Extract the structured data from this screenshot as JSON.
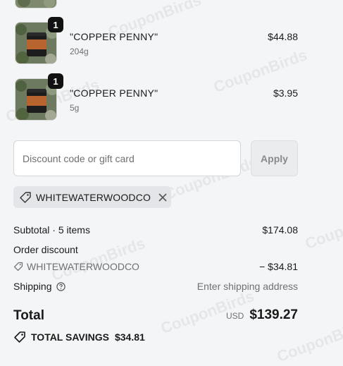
{
  "items": [
    {
      "quantity": "1",
      "name": "\"COPPER PENNY\"",
      "variant": "204g",
      "price": "$44.88"
    },
    {
      "quantity": "1",
      "name": "\"COPPER PENNY\"",
      "variant": "5g",
      "price": "$3.95"
    }
  ],
  "discount": {
    "placeholder": "Discount code or gift card",
    "apply_label": "Apply",
    "applied_code": "WHITEWATERWOODCO"
  },
  "summary": {
    "subtotal_label": "Subtotal · 5 items",
    "subtotal_value": "$174.08",
    "order_discount_label": "Order discount",
    "discount_code": "WHITEWATERWOODCO",
    "discount_value": "− $34.81",
    "shipping_label": "Shipping",
    "shipping_value": "Enter shipping address",
    "total_label": "Total",
    "currency": "USD",
    "total_value": "$139.27",
    "savings_label": "TOTAL SAVINGS",
    "savings_value": "$34.81"
  },
  "watermark": "CouponBirds"
}
